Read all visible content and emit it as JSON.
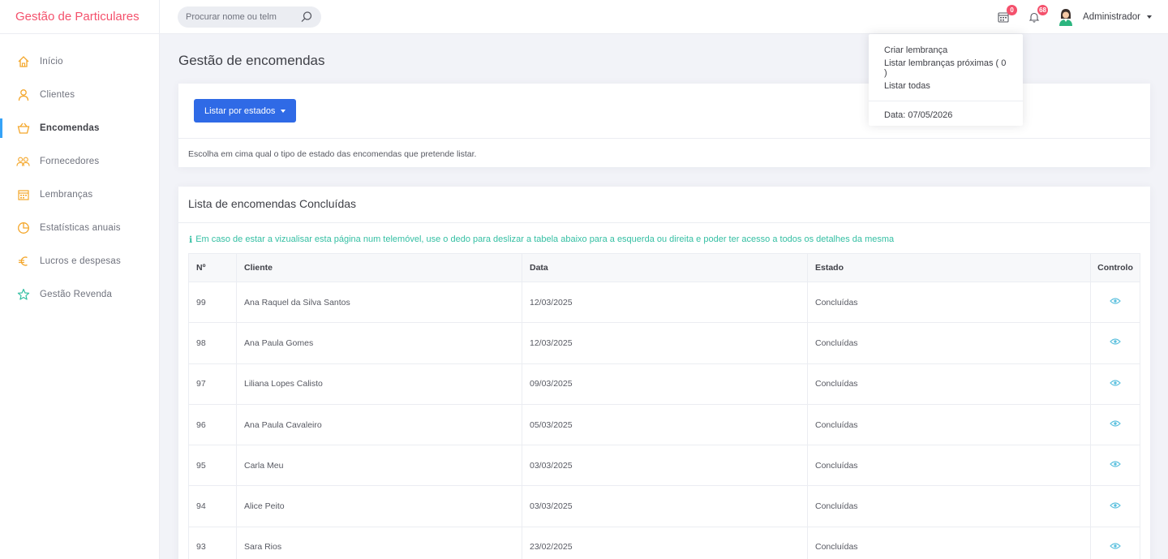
{
  "brand": "Gestão de Particulares",
  "search": {
    "placeholder": "Procurar nome ou telm"
  },
  "topbar": {
    "calendar_badge": "0",
    "bell_badge": "68",
    "user": "Administrador"
  },
  "sidebar": {
    "items": [
      {
        "label": "Início",
        "icon": "home-icon"
      },
      {
        "label": "Clientes",
        "icon": "user-icon"
      },
      {
        "label": "Encomendas",
        "icon": "basket-icon"
      },
      {
        "label": "Fornecedores",
        "icon": "users-icon"
      },
      {
        "label": "Lembranças",
        "icon": "calendar-icon"
      },
      {
        "label": "Estatísticas anuais",
        "icon": "pie-chart-icon"
      },
      {
        "label": "Lucros e despesas",
        "icon": "euro-icon"
      },
      {
        "label": "Gestão Revenda",
        "icon": "star-icon"
      }
    ]
  },
  "page_title": "Gestão de encomendas",
  "filter_card": {
    "button": "Listar por estados",
    "hint": "Escolha em cima qual o tipo de estado das encomendas que pretende listar."
  },
  "list_card": {
    "title": "Lista de encomendas Concluídas",
    "info": "Em caso de estar a vizualisar esta página num telemóvel, use o dedo para deslizar a tabela abaixo para a esquerda ou direita e poder ter acesso a todos os detalhes da mesma",
    "columns": [
      "Nº",
      "Cliente",
      "Data",
      "Estado",
      "Controlo"
    ],
    "rows": [
      {
        "n": "99",
        "cliente": "Ana Raquel da Silva Santos",
        "data": "12/03/2025",
        "estado": "Concluídas"
      },
      {
        "n": "98",
        "cliente": "Ana Paula Gomes",
        "data": "12/03/2025",
        "estado": "Concluídas"
      },
      {
        "n": "97",
        "cliente": "Liliana Lopes Calisto",
        "data": "09/03/2025",
        "estado": "Concluídas"
      },
      {
        "n": "96",
        "cliente": "Ana Paula Cavaleiro",
        "data": "05/03/2025",
        "estado": "Concluídas"
      },
      {
        "n": "95",
        "cliente": "Carla Meu",
        "data": "03/03/2025",
        "estado": "Concluídas"
      },
      {
        "n": "94",
        "cliente": "Alice Peito",
        "data": "03/03/2025",
        "estado": "Concluídas"
      },
      {
        "n": "93",
        "cliente": "Sara Rios",
        "data": "23/02/2025",
        "estado": "Concluídas"
      }
    ]
  },
  "dropdown": {
    "items": [
      "Criar lembrança",
      "Listar lembranças próximas ( 0 )",
      "Listar todas"
    ],
    "date": "Data: 07/05/2026"
  },
  "colors": {
    "brand": "#f4516c",
    "sidebar_icon": "#f4a62a",
    "primary": "#2f6ae6",
    "success": "#34bfa3",
    "eye": "#5bc0de"
  }
}
